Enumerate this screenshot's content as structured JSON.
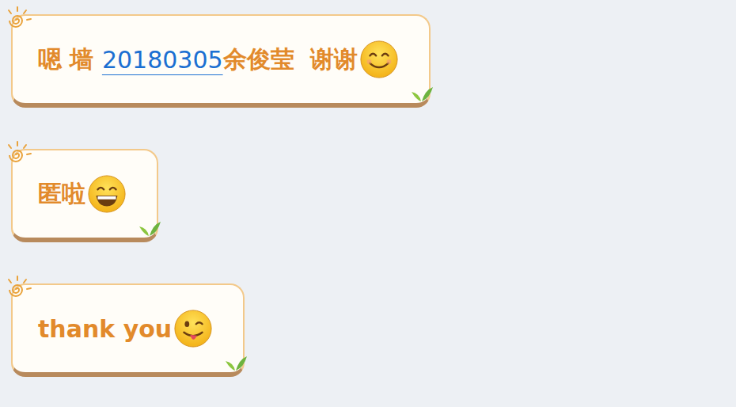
{
  "messages": [
    {
      "parts": [
        {
          "text": "嗯 墙 ",
          "kind": "text"
        },
        {
          "text": "20180305",
          "kind": "link"
        },
        {
          "text": "余俊莹  谢谢",
          "kind": "text"
        }
      ],
      "emoji": "smile"
    },
    {
      "parts": [
        {
          "text": "匿啦",
          "kind": "text"
        }
      ],
      "emoji": "grin"
    },
    {
      "parts": [
        {
          "text": "thank you",
          "kind": "text"
        }
      ],
      "emoji": "wink"
    }
  ]
}
